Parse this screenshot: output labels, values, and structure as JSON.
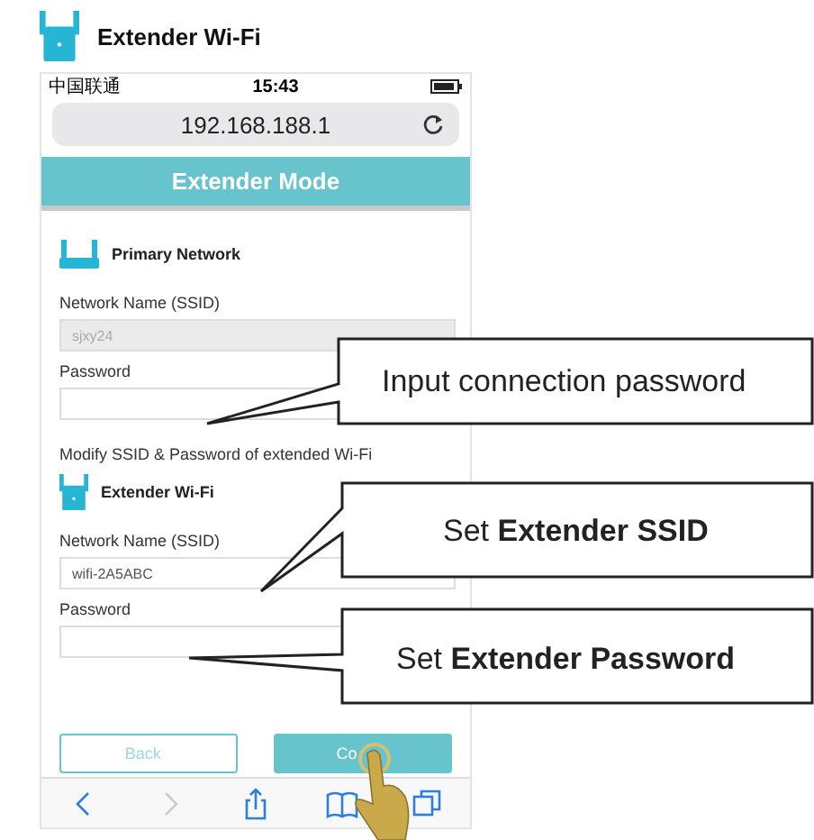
{
  "header": {
    "title": "Extender Wi-Fi"
  },
  "status_bar": {
    "carrier": "中国联通",
    "time": "15:43"
  },
  "address_bar": {
    "url": "192.168.188.1"
  },
  "page_header": {
    "title": "Extender Mode"
  },
  "sections": [
    {
      "kind": "router",
      "heading": "Primary Network",
      "fields": [
        {
          "label": "Network Name (SSID)",
          "value": "sjxy24",
          "disabled": true
        },
        {
          "label": "Password",
          "disabled": false
        }
      ]
    },
    {
      "kind": "note",
      "text": "Modify SSID & Password of extended Wi-Fi"
    },
    {
      "kind": "extender",
      "heading": "Extender Wi-Fi",
      "fields": [
        {
          "label": "Network Name (SSID)",
          "value": "wifi-2A5ABC",
          "disabled": false
        },
        {
          "label": "Password",
          "disabled": false
        }
      ]
    }
  ],
  "buttons": [
    {
      "label": "Back",
      "kind": "outline"
    },
    {
      "label": "Co",
      "kind": "primary"
    }
  ],
  "toolbar": [
    {
      "kind": "back",
      "disabled": false
    },
    {
      "kind": "forward",
      "disabled": true
    },
    {
      "kind": "share",
      "disabled": false
    },
    {
      "kind": "bookmarks",
      "disabled": false
    },
    {
      "kind": "tabs",
      "disabled": false
    }
  ],
  "callouts": [
    {
      "text": "Input connection password"
    },
    {
      "text": "Set **Extender SSID**"
    },
    {
      "text": "Set **Extender Password**"
    }
  ]
}
